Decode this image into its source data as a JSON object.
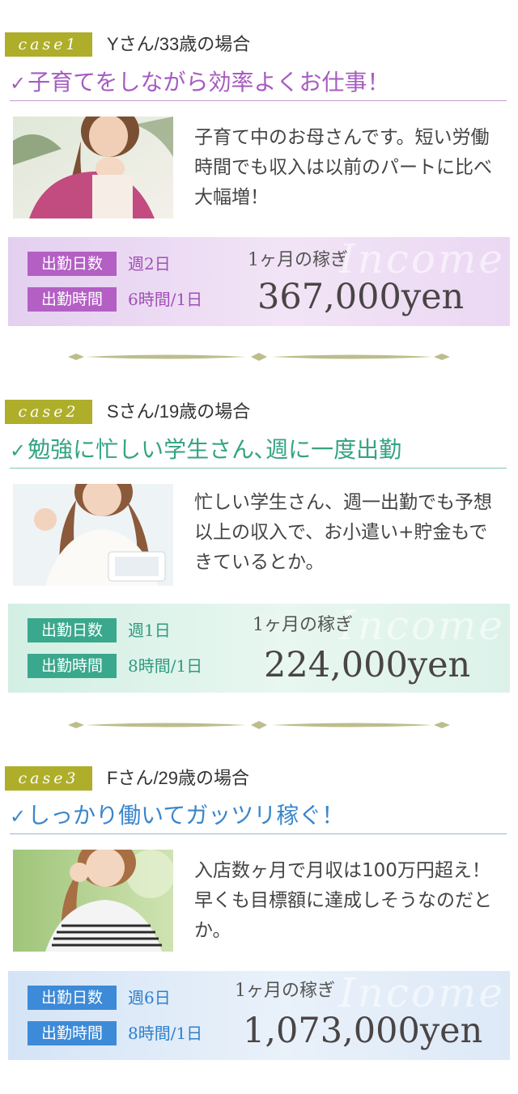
{
  "cases": [
    {
      "tag": "case1",
      "person": "Yさん/33歳の場合",
      "headline_check": "✓",
      "headline": "子育てをしながら効率よくお仕事！",
      "description": "子育て中のお母さんです。短い労働時間でも収入は以前のパートに比べ大幅増！",
      "days_label": "出勤日数",
      "days_value": "週2日",
      "hours_label": "出勤時間",
      "hours_value": "6時間/1日",
      "income_label": "1ヶ月の稼ぎ",
      "amount": "367,000yen",
      "watermark": "Income",
      "accent": "#b666c2"
    },
    {
      "tag": "case2",
      "person": "Sさん/19歳の場合",
      "headline_check": "✓",
      "headline": "勉強に忙しい学生さん､週に一度出勤",
      "description": "忙しい学生さん、週一出勤でも予想以上の収入で、お小遣い+貯金もできているとか。",
      "days_label": "出勤日数",
      "days_value": "週1日",
      "hours_label": "出勤時間",
      "hours_value": "8時間/1日",
      "income_label": "1ヶ月の稼ぎ",
      "amount": "224,000yen",
      "watermark": "Income",
      "accent": "#3aa88c"
    },
    {
      "tag": "case3",
      "person": "Fさん/29歳の場合",
      "headline_check": "✓",
      "headline": "しっかり働いてガッツリ稼ぐ！",
      "description": "入店数ヶ月で月収は100万円超え！早くも目標額に達成しそうなのだとか。",
      "days_label": "出勤日数",
      "days_value": "週6日",
      "hours_label": "出勤時間",
      "hours_value": "8時間/1日",
      "income_label": "1ヶ月の稼ぎ",
      "amount": "1,073,000yen",
      "watermark": "Income",
      "accent": "#3d8ad8"
    }
  ]
}
